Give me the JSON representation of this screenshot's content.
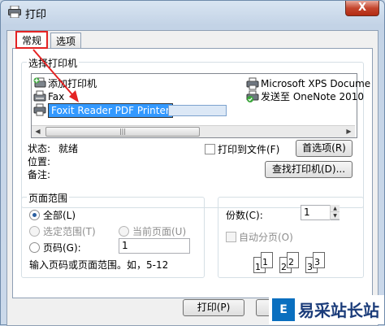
{
  "window": {
    "title": "打印",
    "close_label": "X"
  },
  "tabs": [
    {
      "label": "常规"
    },
    {
      "label": "选项"
    }
  ],
  "select_printer": {
    "group_label": "选择打印机",
    "left_items": [
      {
        "label": "添加打印机",
        "icon": "add-printer-icon"
      },
      {
        "label": "Fax",
        "icon": "fax-icon"
      },
      {
        "label": "Foxit Reader PDF Printer",
        "icon": "printer-icon",
        "selected": true
      }
    ],
    "right_items": [
      {
        "label": "Microsoft XPS Docume",
        "icon": "printer-icon"
      },
      {
        "label": "发送至 OneNote 2010",
        "icon": "printer-icon"
      }
    ],
    "status_label": "状态:",
    "status_value": "就绪",
    "location_label": "位置:",
    "location_value": "",
    "comment_label": "备注:",
    "comment_value": "",
    "print_to_file_label": "打印到文件(F)",
    "preferences_label": "首选项(R)",
    "find_printer_label": "查找打印机(D)..."
  },
  "page_range": {
    "group_label": "页面范围",
    "all_label": "全部(L)",
    "selection_label": "选定范围(T)",
    "current_page_label": "当前页面(U)",
    "pages_label": "页码(G):",
    "pages_value": "1",
    "hint": "输入页码或页面范围。如，5-12"
  },
  "copies": {
    "label": "份数(C):",
    "value": "1",
    "collate_label": "自动分页(O)",
    "collate_numbers": [
      "1",
      "1",
      "2",
      "2",
      "3",
      "3"
    ]
  },
  "footer": {
    "print_label": "打印(P)",
    "cancel_label": "取"
  },
  "watermark": {
    "logo": "E",
    "text": "易采站长站"
  },
  "colors": {
    "highlight": "#3399ff",
    "annotation_red": "#e42323"
  }
}
